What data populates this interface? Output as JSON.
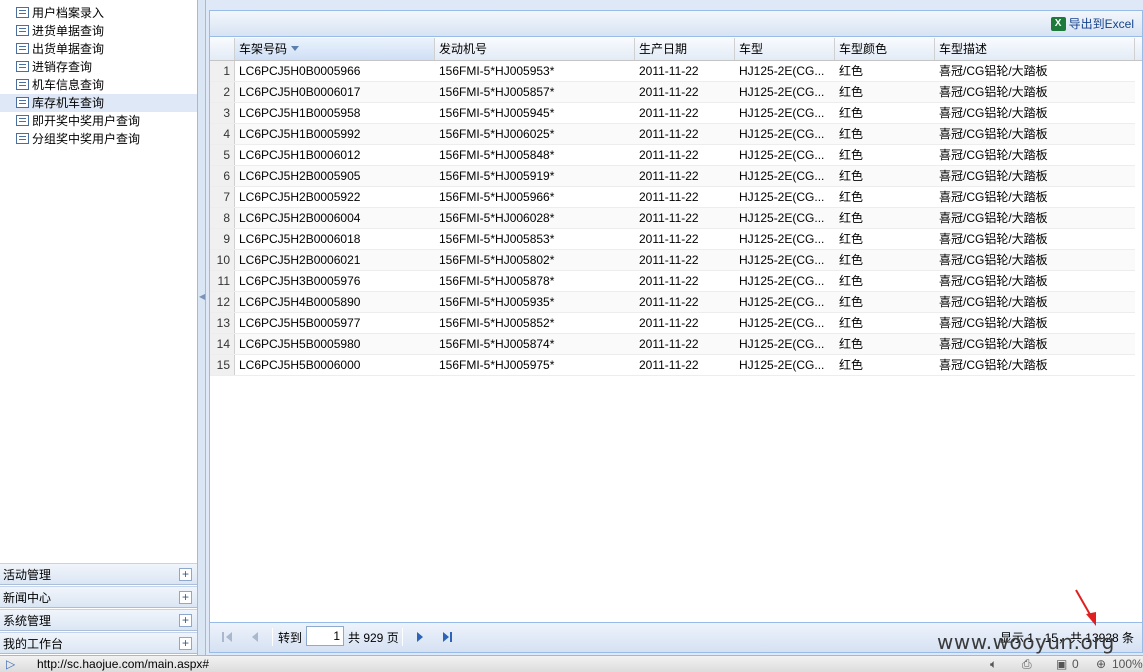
{
  "sidebar": {
    "tree_items": [
      {
        "label": "用户档案录入",
        "selected": false
      },
      {
        "label": "进货单据查询",
        "selected": false
      },
      {
        "label": "出货单据查询",
        "selected": false
      },
      {
        "label": "进销存查询",
        "selected": false
      },
      {
        "label": "机车信息查询",
        "selected": false
      },
      {
        "label": "库存机车查询",
        "selected": true
      },
      {
        "label": "即开奖中奖用户查询",
        "selected": false
      },
      {
        "label": "分组奖中奖用户查询",
        "selected": false
      }
    ],
    "accordion": [
      {
        "label": "活动管理"
      },
      {
        "label": "新闻中心"
      },
      {
        "label": "系统管理"
      },
      {
        "label": "我的工作台"
      }
    ]
  },
  "toolbar": {
    "export_label": "导出到Excel"
  },
  "grid": {
    "columns": [
      "车架号码",
      "发动机号",
      "生产日期",
      "车型",
      "车型颜色",
      "车型描述"
    ],
    "sorted_column": 0,
    "rows": [
      {
        "n": "1",
        "vin": "LC6PCJ5H0B0005966",
        "engine": "156FMI-5*HJ005953*",
        "date": "2011-11-22",
        "model": "HJ125-2E(CG...",
        "color": "红色",
        "desc": "喜冠/CG铝轮/大踏板"
      },
      {
        "n": "2",
        "vin": "LC6PCJ5H0B0006017",
        "engine": "156FMI-5*HJ005857*",
        "date": "2011-11-22",
        "model": "HJ125-2E(CG...",
        "color": "红色",
        "desc": "喜冠/CG铝轮/大踏板"
      },
      {
        "n": "3",
        "vin": "LC6PCJ5H1B0005958",
        "engine": "156FMI-5*HJ005945*",
        "date": "2011-11-22",
        "model": "HJ125-2E(CG...",
        "color": "红色",
        "desc": "喜冠/CG铝轮/大踏板"
      },
      {
        "n": "4",
        "vin": "LC6PCJ5H1B0005992",
        "engine": "156FMI-5*HJ006025*",
        "date": "2011-11-22",
        "model": "HJ125-2E(CG...",
        "color": "红色",
        "desc": "喜冠/CG铝轮/大踏板"
      },
      {
        "n": "5",
        "vin": "LC6PCJ5H1B0006012",
        "engine": "156FMI-5*HJ005848*",
        "date": "2011-11-22",
        "model": "HJ125-2E(CG...",
        "color": "红色",
        "desc": "喜冠/CG铝轮/大踏板"
      },
      {
        "n": "6",
        "vin": "LC6PCJ5H2B0005905",
        "engine": "156FMI-5*HJ005919*",
        "date": "2011-11-22",
        "model": "HJ125-2E(CG...",
        "color": "红色",
        "desc": "喜冠/CG铝轮/大踏板"
      },
      {
        "n": "7",
        "vin": "LC6PCJ5H2B0005922",
        "engine": "156FMI-5*HJ005966*",
        "date": "2011-11-22",
        "model": "HJ125-2E(CG...",
        "color": "红色",
        "desc": "喜冠/CG铝轮/大踏板"
      },
      {
        "n": "8",
        "vin": "LC6PCJ5H2B0006004",
        "engine": "156FMI-5*HJ006028*",
        "date": "2011-11-22",
        "model": "HJ125-2E(CG...",
        "color": "红色",
        "desc": "喜冠/CG铝轮/大踏板"
      },
      {
        "n": "9",
        "vin": "LC6PCJ5H2B0006018",
        "engine": "156FMI-5*HJ005853*",
        "date": "2011-11-22",
        "model": "HJ125-2E(CG...",
        "color": "红色",
        "desc": "喜冠/CG铝轮/大踏板"
      },
      {
        "n": "10",
        "vin": "LC6PCJ5H2B0006021",
        "engine": "156FMI-5*HJ005802*",
        "date": "2011-11-22",
        "model": "HJ125-2E(CG...",
        "color": "红色",
        "desc": "喜冠/CG铝轮/大踏板"
      },
      {
        "n": "11",
        "vin": "LC6PCJ5H3B0005976",
        "engine": "156FMI-5*HJ005878*",
        "date": "2011-11-22",
        "model": "HJ125-2E(CG...",
        "color": "红色",
        "desc": "喜冠/CG铝轮/大踏板"
      },
      {
        "n": "12",
        "vin": "LC6PCJ5H4B0005890",
        "engine": "156FMI-5*HJ005935*",
        "date": "2011-11-22",
        "model": "HJ125-2E(CG...",
        "color": "红色",
        "desc": "喜冠/CG铝轮/大踏板"
      },
      {
        "n": "13",
        "vin": "LC6PCJ5H5B0005977",
        "engine": "156FMI-5*HJ005852*",
        "date": "2011-11-22",
        "model": "HJ125-2E(CG...",
        "color": "红色",
        "desc": "喜冠/CG铝轮/大踏板"
      },
      {
        "n": "14",
        "vin": "LC6PCJ5H5B0005980",
        "engine": "156FMI-5*HJ005874*",
        "date": "2011-11-22",
        "model": "HJ125-2E(CG...",
        "color": "红色",
        "desc": "喜冠/CG铝轮/大踏板"
      },
      {
        "n": "15",
        "vin": "LC6PCJ5H5B0006000",
        "engine": "156FMI-5*HJ005975*",
        "date": "2011-11-22",
        "model": "HJ125-2E(CG...",
        "color": "红色",
        "desc": "喜冠/CG铝轮/大踏板"
      }
    ]
  },
  "pager": {
    "goto_label": "转到",
    "page_value": "1",
    "total_pages_label": "共 929 页",
    "display_info": "显示 1 - 15，共 13928 条"
  },
  "statusbar": {
    "url": "http://sc.haojue.com/main.aspx#",
    "count": "0",
    "zoom": "100%"
  },
  "watermark": "www.wooyun.org",
  "colors": {
    "accent_border": "#99bbe8",
    "panel_bg": "#dfe8f6",
    "selected_row": "#dfe8f6",
    "annotation_arrow": "#e02020"
  }
}
